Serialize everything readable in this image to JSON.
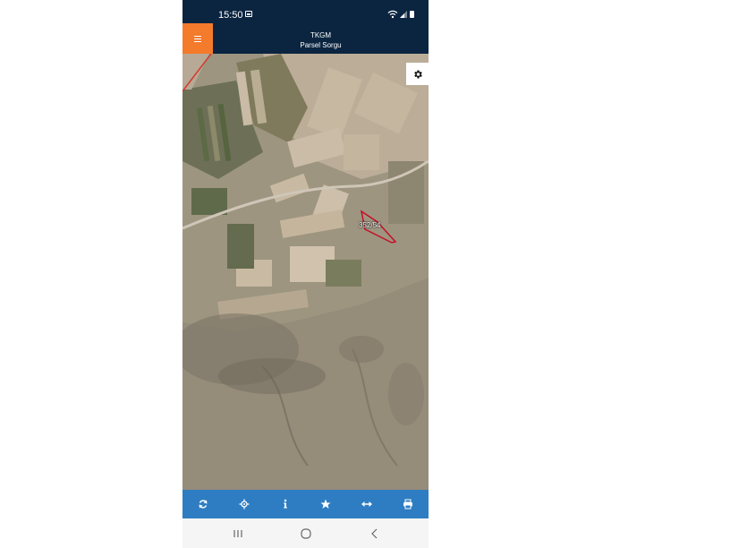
{
  "status_bar": {
    "time": "15:50",
    "icons": [
      "gallery-icon",
      "wifi-icon",
      "signal-icon",
      "battery-icon"
    ]
  },
  "app_bar": {
    "title": "TKGM",
    "subtitle": "Parsel Sorgu",
    "menu_icon": "hamburger-menu-icon",
    "colors": {
      "background": "#0b2540",
      "menu_button": "#f47a2c"
    }
  },
  "map": {
    "settings_icon": "gear-icon",
    "parcel_label": "352/54",
    "parcel_outline_color": "#c4102a"
  },
  "toolbar": {
    "background": "#2e7dc2",
    "buttons": [
      {
        "name": "refresh",
        "icon": "refresh-icon"
      },
      {
        "name": "locate",
        "icon": "crosshair-icon"
      },
      {
        "name": "info",
        "icon": "info-icon"
      },
      {
        "name": "favorites",
        "icon": "star-icon"
      },
      {
        "name": "measure",
        "icon": "arrows-horizontal-icon"
      },
      {
        "name": "print",
        "icon": "print-icon"
      }
    ]
  },
  "nav_bar": {
    "buttons": [
      "recent-apps-icon",
      "home-icon",
      "back-icon"
    ]
  }
}
